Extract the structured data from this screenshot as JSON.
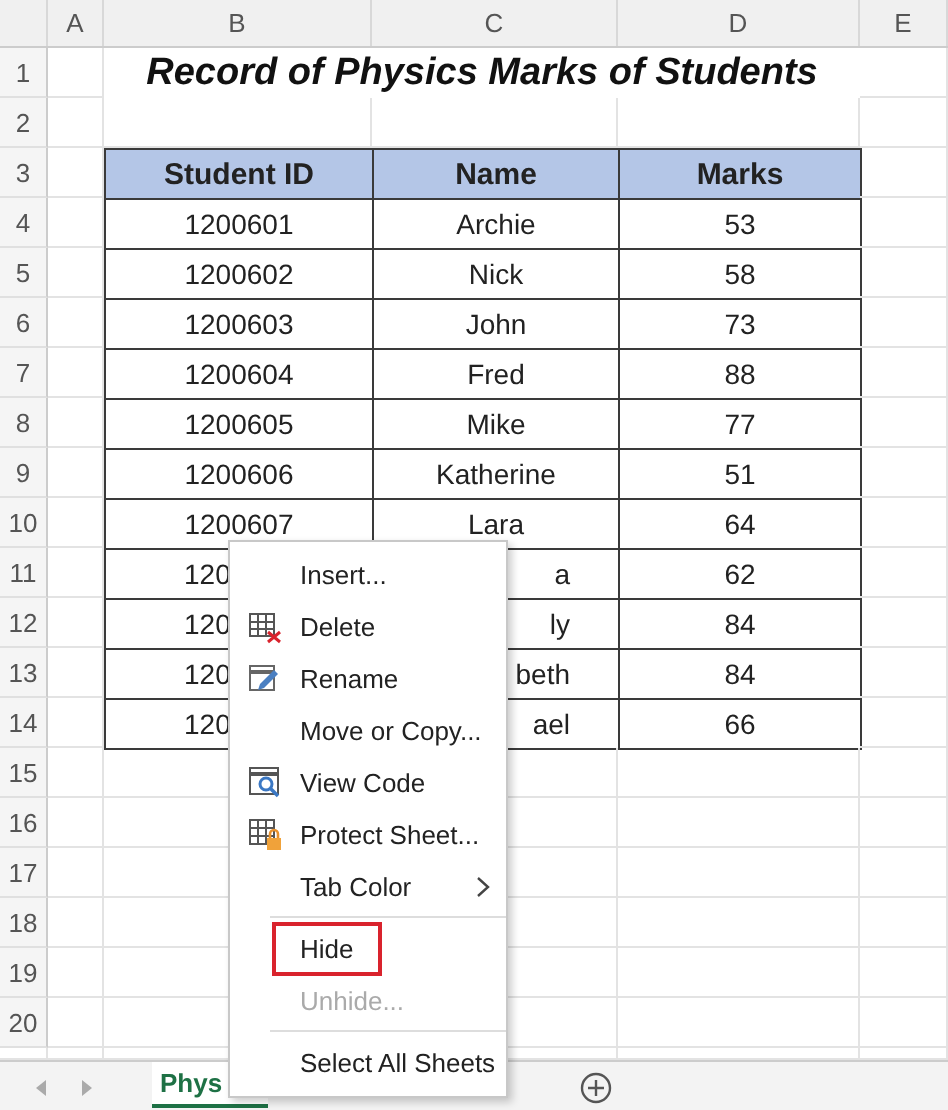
{
  "column_headers": [
    "A",
    "B",
    "C",
    "D",
    "E"
  ],
  "row_headers": [
    "1",
    "2",
    "3",
    "4",
    "5",
    "6",
    "7",
    "8",
    "9",
    "10",
    "11",
    "12",
    "13",
    "14",
    "15",
    "16",
    "17",
    "18",
    "19",
    "20"
  ],
  "title": "Record of Physics Marks of Students",
  "table": {
    "columns": [
      "Student ID",
      "Name",
      "Marks"
    ],
    "rows": [
      [
        {
          "text": "1200601"
        },
        {
          "text": "Archie"
        },
        {
          "text": "53"
        }
      ],
      [
        {
          "text": "1200602"
        },
        {
          "text": "Nick"
        },
        {
          "text": "58"
        }
      ],
      [
        {
          "text": "1200603"
        },
        {
          "text": "John"
        },
        {
          "text": "73"
        }
      ],
      [
        {
          "text": "1200604"
        },
        {
          "text": "Fred"
        },
        {
          "text": "88"
        }
      ],
      [
        {
          "text": "1200605"
        },
        {
          "text": "Mike"
        },
        {
          "text": "77"
        }
      ],
      [
        {
          "text": "1200606"
        },
        {
          "text": "Katherine"
        },
        {
          "text": "51"
        }
      ],
      [
        {
          "text": "1200607"
        },
        {
          "text": "Lara"
        },
        {
          "text": "64"
        }
      ],
      [
        {
          "text": "120",
          "covered": true
        },
        {
          "text": "a",
          "covered": true
        },
        {
          "text": "62"
        }
      ],
      [
        {
          "text": "120",
          "covered": true
        },
        {
          "text": "ly",
          "covered": true
        },
        {
          "text": "84"
        }
      ],
      [
        {
          "text": "120",
          "covered": true
        },
        {
          "text": "beth",
          "covered": true
        },
        {
          "text": "84"
        }
      ],
      [
        {
          "text": "120",
          "covered": true
        },
        {
          "text": "ael",
          "covered": true
        },
        {
          "text": "66"
        }
      ]
    ]
  },
  "context_menu": {
    "items": [
      {
        "kind": "plain",
        "label": "Insert...",
        "disabled": false,
        "highlighted": false,
        "submenu": false
      },
      {
        "kind": "delete",
        "label": "Delete",
        "disabled": false,
        "highlighted": false,
        "submenu": false
      },
      {
        "kind": "rename",
        "label": "Rename",
        "disabled": false,
        "highlighted": false,
        "submenu": false
      },
      {
        "kind": "plain",
        "label": "Move or Copy...",
        "disabled": false,
        "highlighted": false,
        "submenu": false
      },
      {
        "kind": "code",
        "label": "View Code",
        "disabled": false,
        "highlighted": false,
        "submenu": false
      },
      {
        "kind": "protect",
        "label": "Protect Sheet...",
        "disabled": false,
        "highlighted": false,
        "submenu": false
      },
      {
        "kind": "plain",
        "label": "Tab Color",
        "disabled": false,
        "highlighted": false,
        "submenu": true
      },
      {
        "kind": "separator"
      },
      {
        "kind": "plain",
        "label": "Hide",
        "disabled": false,
        "highlighted": true,
        "submenu": false
      },
      {
        "kind": "plain",
        "label": "Unhide...",
        "disabled": true,
        "highlighted": false,
        "submenu": false
      },
      {
        "kind": "separator"
      },
      {
        "kind": "plain",
        "label": "Select All Sheets",
        "disabled": false,
        "highlighted": false,
        "submenu": false
      }
    ]
  },
  "sheet_tabs": [
    {
      "label": "Phys",
      "selected": true
    }
  ]
}
